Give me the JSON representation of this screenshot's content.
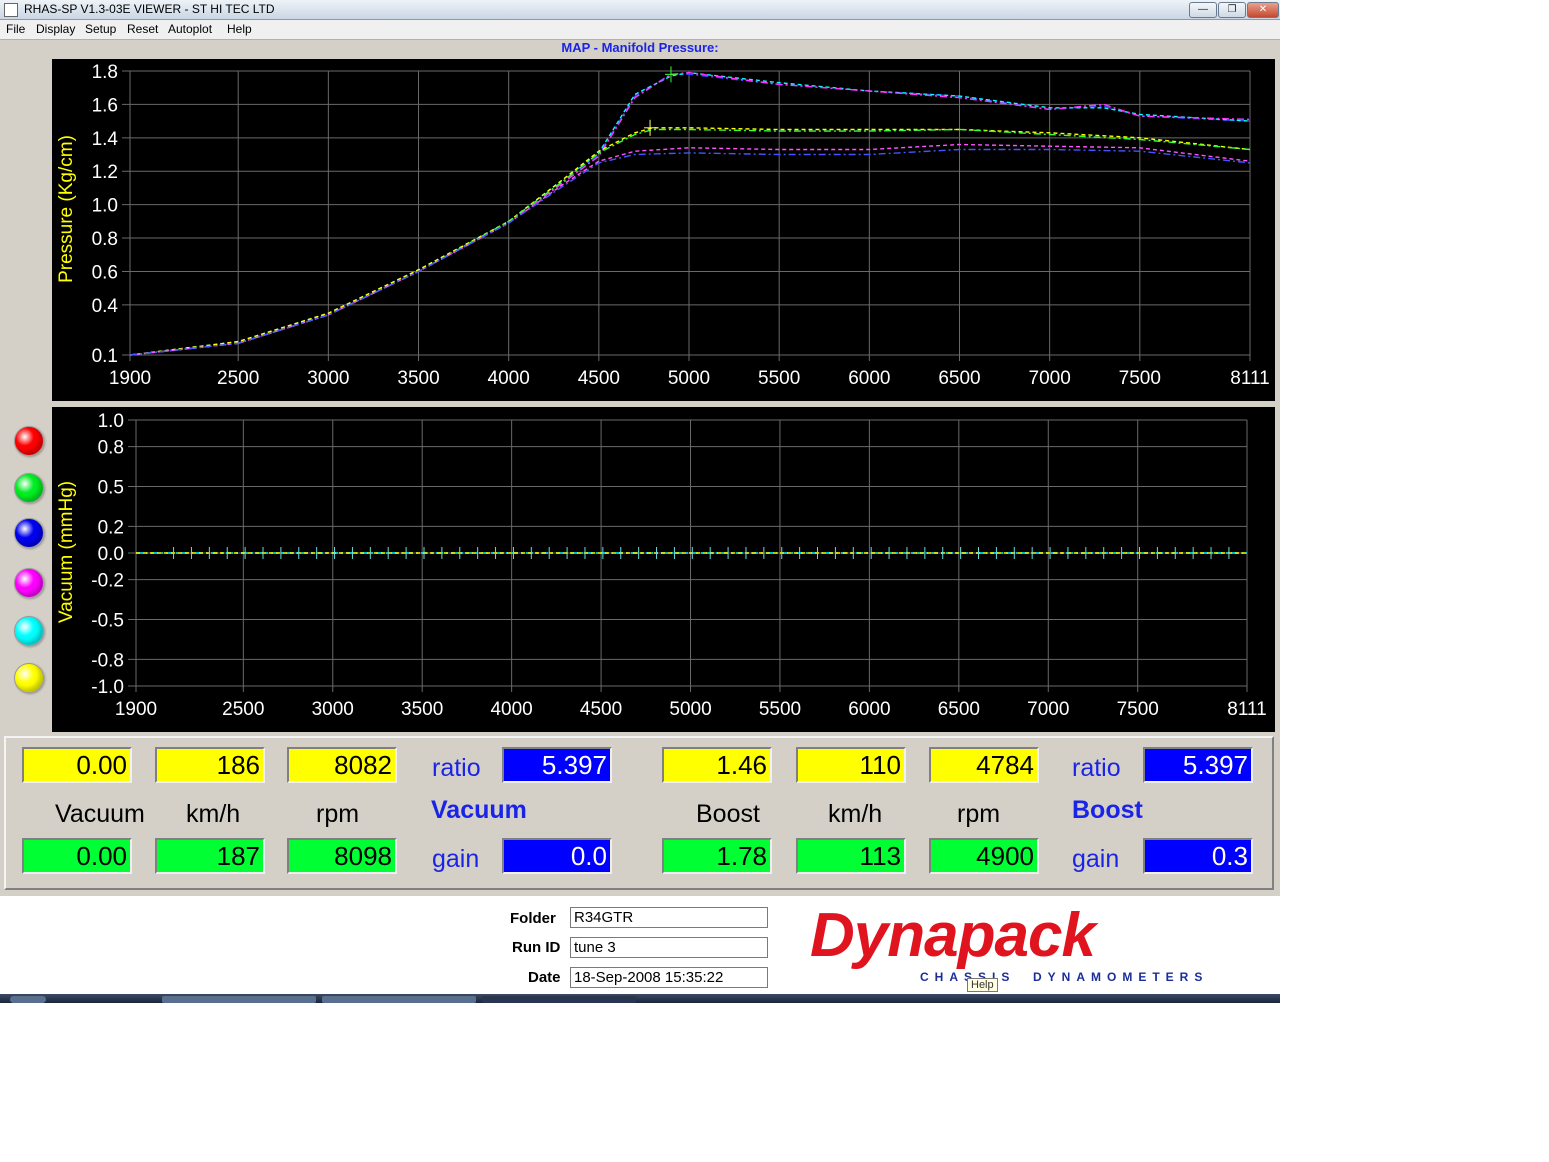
{
  "window": {
    "title": "RHAS-SP V1.3-03E VIEWER - ST HI TEC LTD",
    "minimize_glyph": "—",
    "maximize_glyph": "❐",
    "close_glyph": "✕"
  },
  "menu": {
    "file": "File",
    "display": "Display",
    "setup": "Setup",
    "reset": "Reset",
    "autoplot": "Autoplot",
    "help": "Help"
  },
  "chart_title": "MAP - Manifold Pressure:",
  "chart_data": [
    {
      "type": "line",
      "title": "MAP - Manifold Pressure:",
      "ylabel": "Pressure (Kg/cm)",
      "xlabel": "",
      "xlim": [
        1900,
        8111
      ],
      "ylim": [
        0.1,
        1.8
      ],
      "x_ticks": [
        "1900",
        "2500",
        "3000",
        "3500",
        "4000",
        "4500",
        "5000",
        "5500",
        "6000",
        "6500",
        "7000",
        "7500",
        "8111"
      ],
      "y_ticks": [
        "0.1",
        "0.4",
        "0.6",
        "0.8",
        "1.0",
        "1.2",
        "1.4",
        "1.6",
        "1.8"
      ],
      "grid": true,
      "background": "#000000",
      "series": [
        {
          "color": "#3344ff",
          "x": [
            1900,
            2500,
            3000,
            3500,
            4000,
            4300,
            4500,
            4700,
            4900,
            5000,
            5500,
            6000,
            6500,
            7000,
            7300,
            7500,
            8111
          ],
          "y": [
            0.1,
            0.17,
            0.34,
            0.6,
            0.9,
            1.14,
            1.3,
            1.65,
            1.78,
            1.78,
            1.72,
            1.68,
            1.65,
            1.57,
            1.59,
            1.53,
            1.5
          ]
        },
        {
          "color": "#00ffff",
          "x": [
            1900,
            2500,
            3000,
            3500,
            4000,
            4300,
            4500,
            4700,
            4900,
            5000,
            5500,
            6000,
            6500,
            7000,
            7300,
            7500,
            8111
          ],
          "y": [
            0.1,
            0.18,
            0.35,
            0.61,
            0.9,
            1.15,
            1.31,
            1.66,
            1.77,
            1.79,
            1.73,
            1.68,
            1.65,
            1.58,
            1.58,
            1.54,
            1.5
          ]
        },
        {
          "color": "#ff33ff",
          "x": [
            1900,
            2500,
            3000,
            3500,
            4000,
            4300,
            4500,
            4700,
            4900,
            5000,
            5500,
            6000,
            6500,
            7000,
            7300,
            7500,
            8111
          ],
          "y": [
            0.1,
            0.17,
            0.34,
            0.6,
            0.89,
            1.13,
            1.29,
            1.64,
            1.78,
            1.79,
            1.72,
            1.68,
            1.64,
            1.57,
            1.6,
            1.53,
            1.51
          ]
        },
        {
          "color": "#ffff00",
          "x": [
            1900,
            2500,
            3000,
            3500,
            4000,
            4300,
            4500,
            4700,
            4800,
            5000,
            5500,
            6000,
            6500,
            7000,
            7500,
            8111
          ],
          "y": [
            0.1,
            0.18,
            0.35,
            0.61,
            0.9,
            1.15,
            1.32,
            1.43,
            1.46,
            1.46,
            1.45,
            1.45,
            1.45,
            1.43,
            1.4,
            1.33
          ]
        },
        {
          "color": "#33ff33",
          "x": [
            1900,
            2500,
            3000,
            3500,
            4000,
            4300,
            4500,
            4700,
            4800,
            5000,
            5500,
            6000,
            6500,
            7000,
            7500,
            8111
          ],
          "y": [
            0.1,
            0.17,
            0.34,
            0.6,
            0.9,
            1.14,
            1.31,
            1.42,
            1.45,
            1.45,
            1.44,
            1.44,
            1.45,
            1.42,
            1.39,
            1.33
          ]
        },
        {
          "color": "#ff55ff",
          "x": [
            1900,
            2500,
            3000,
            3500,
            4000,
            4300,
            4500,
            4700,
            5000,
            5500,
            6000,
            6500,
            7000,
            7500,
            8111
          ],
          "y": [
            0.1,
            0.17,
            0.34,
            0.6,
            0.89,
            1.12,
            1.26,
            1.32,
            1.34,
            1.33,
            1.33,
            1.36,
            1.35,
            1.34,
            1.26
          ]
        },
        {
          "color": "#4455ff",
          "x": [
            1900,
            2500,
            3000,
            3500,
            4000,
            4300,
            4500,
            4700,
            5000,
            5500,
            6000,
            6500,
            7000,
            7500,
            8111
          ],
          "y": [
            0.1,
            0.17,
            0.34,
            0.6,
            0.89,
            1.11,
            1.25,
            1.3,
            1.31,
            1.3,
            1.3,
            1.33,
            1.33,
            1.32,
            1.25
          ]
        }
      ]
    },
    {
      "type": "line",
      "title": "",
      "ylabel": "Vacuum (mmHg)",
      "xlabel": "",
      "xlim": [
        1900,
        8111
      ],
      "ylim": [
        -1.0,
        1.0
      ],
      "x_ticks": [
        "1900",
        "2500",
        "3000",
        "3500",
        "4000",
        "4500",
        "5000",
        "5500",
        "6000",
        "6500",
        "7000",
        "7500",
        "8111"
      ],
      "y_ticks": [
        "1.0",
        "0.8",
        "0.5",
        "0.2",
        "0.0",
        "-0.2",
        "-0.5",
        "-0.8",
        "-1.0"
      ],
      "grid": true,
      "background": "#000000",
      "series": [
        {
          "color": "#00ffff",
          "x": [
            1900,
            8111
          ],
          "y": [
            0.0,
            0.0
          ]
        },
        {
          "color": "#ffff00",
          "x": [
            1900,
            8111
          ],
          "y": [
            0.0,
            0.0
          ]
        }
      ]
    }
  ],
  "legend_colors": [
    "#ff0000",
    "#00ee22",
    "#0000ee",
    "#ff00ff",
    "#00ffff",
    "#ffff00"
  ],
  "readout": {
    "vacuum": {
      "top_values": [
        "0.00",
        "186",
        "8082"
      ],
      "labels": [
        "Vacuum",
        "km/h",
        "rpm"
      ],
      "bottom_values": [
        "0.00",
        "187",
        "8098"
      ],
      "ratio_label": "ratio",
      "ratio_value": "5.397",
      "section_title": "Vacuum",
      "gain_label": "gain",
      "gain_value": "0.0"
    },
    "boost": {
      "top_values": [
        "1.46",
        "110",
        "4784"
      ],
      "labels": [
        "Boost",
        "km/h",
        "rpm"
      ],
      "bottom_values": [
        "1.78",
        "113",
        "4900"
      ],
      "ratio_label": "ratio",
      "ratio_value": "5.397",
      "section_title": "Boost",
      "gain_label": "gain",
      "gain_value": "0.3"
    }
  },
  "info": {
    "folder_label": "Folder",
    "folder_value": "R34GTR",
    "run_id_label": "Run ID",
    "run_id_value": "tune 3",
    "date_label": "Date",
    "date_value": "18-Sep-2008  15:35:22"
  },
  "logo": {
    "name": "Dynapack",
    "tagline_left": "CHASSIS",
    "tagline_right": "DYNAMOMETERS"
  },
  "tooltip": "Help"
}
